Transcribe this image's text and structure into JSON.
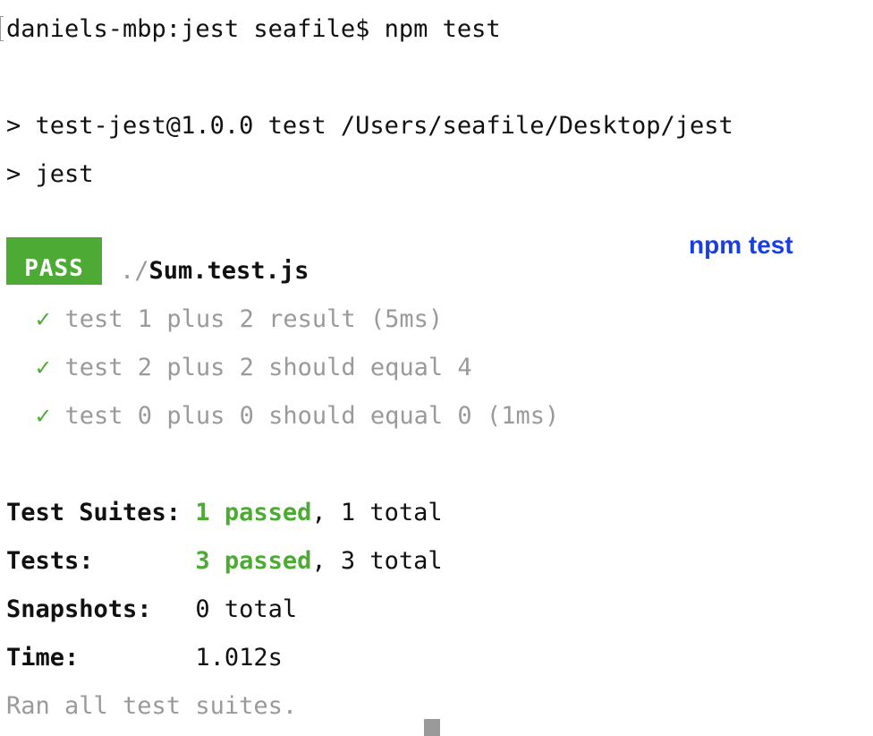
{
  "terminal": {
    "prompt_line": "daniels-mbp:jest seafile$ npm test",
    "script_line": "> test-jest@1.0.0 test /Users/seafile/Desktop/jest",
    "jest_line": "> jest",
    "pass_badge": "PASS",
    "test_file": {
      "prefix": "./",
      "name": "Sum.test.js"
    },
    "tests": [
      {
        "check": "✓",
        "label": "test 1 plus 2 result (5ms)"
      },
      {
        "check": "✓",
        "label": "test 2 plus 2 should equal 4"
      },
      {
        "check": "✓",
        "label": "test 0 plus 0 should equal 0 (1ms)"
      }
    ],
    "summary": {
      "suites": {
        "label": "Test Suites:",
        "passed": "1 passed",
        "rest": ", 1 total"
      },
      "tests": {
        "label": "Tests:",
        "passed": "3 passed",
        "rest": ", 3 total"
      },
      "snapshots": {
        "label": "Snapshots:",
        "value": "0 total"
      },
      "time": {
        "label": "Time:",
        "value": "1.012s"
      }
    },
    "footer": "Ran all test suites."
  },
  "annotation": "npm test",
  "colors": {
    "pass_green": "#4caa35",
    "dim_gray": "#9a9a9a",
    "annotation_blue": "#1a3fe0"
  }
}
